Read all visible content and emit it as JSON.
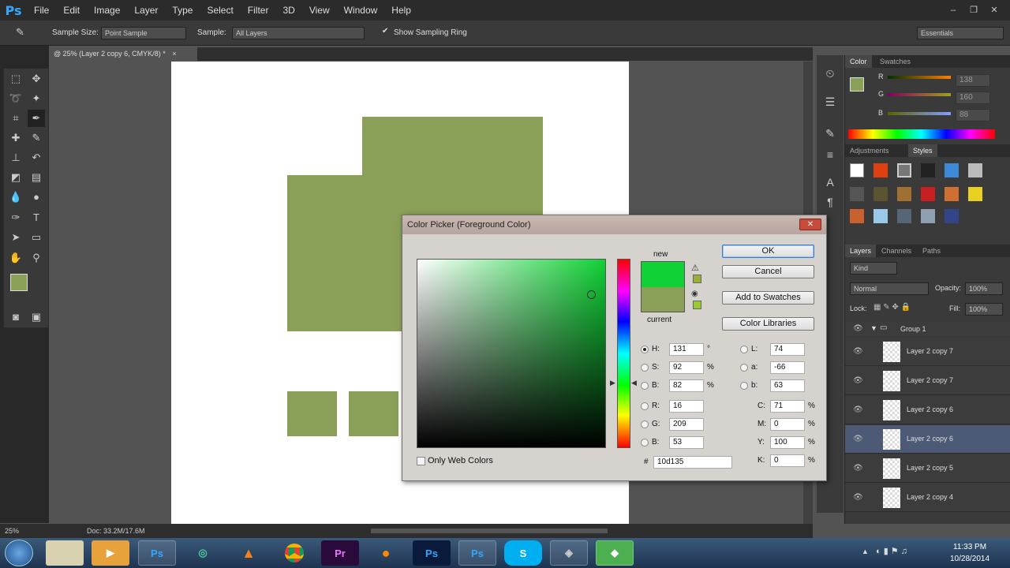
{
  "app": {
    "logo": "Ps"
  },
  "menu": [
    "File",
    "Edit",
    "Image",
    "Layer",
    "Type",
    "Select",
    "Filter",
    "3D",
    "View",
    "Window",
    "Help"
  ],
  "window_controls": [
    "–",
    "❐",
    "✕"
  ],
  "options_bar": {
    "sample_size_label": "Sample Size:",
    "sample_size_value": "Point Sample",
    "sample_label": "Sample:",
    "sample_value": "All Layers",
    "show_ring_label": "Show Sampling Ring",
    "workspace": "Essentials"
  },
  "document_tab": {
    "title": "@ 25% (Layer 2 copy 6, CMYK/8) *",
    "close": "×"
  },
  "status_bar": {
    "zoom": "25%",
    "doc": "Doc: 33.2M/17.6M"
  },
  "color_panel": {
    "tabs": [
      "Color",
      "Swatches"
    ],
    "fg_color": "#8a9f58",
    "sliders": [
      {
        "label": "R",
        "value": "138"
      },
      {
        "label": "G",
        "value": "160"
      },
      {
        "label": "B",
        "value": "88"
      }
    ]
  },
  "styles_panel": {
    "tabs": [
      "Adjustments",
      "Styles"
    ]
  },
  "layers_panel": {
    "tabs": [
      "Layers",
      "Channels",
      "Paths"
    ],
    "kind": "Kind",
    "blend_mode": "Normal",
    "opacity_label": "Opacity:",
    "opacity_value": "100%",
    "lock_label": "Lock:",
    "fill_label": "Fill:",
    "fill_value": "100%",
    "group_name": "Group 1",
    "layers": [
      "Layer 2 copy 7",
      "Layer 2 copy 7",
      "Layer 2 copy 6",
      "Layer 2 copy 6",
      "Layer 2 copy 5",
      "Layer 2 copy 4"
    ]
  },
  "dialog": {
    "title": "Color Picker (Foreground Color)",
    "close": "✕",
    "new_label": "new",
    "current_label": "current",
    "new_color": "#10d135",
    "current_color": "#8a9f58",
    "ok": "OK",
    "cancel": "Cancel",
    "add_swatches": "Add to Swatches",
    "color_libraries": "Color Libraries",
    "hsb": [
      {
        "label": "H:",
        "value": "131",
        "unit": "°"
      },
      {
        "label": "S:",
        "value": "92",
        "unit": "%"
      },
      {
        "label": "B:",
        "value": "82",
        "unit": "%"
      }
    ],
    "rgb": [
      {
        "label": "R:",
        "value": "16"
      },
      {
        "label": "G:",
        "value": "209"
      },
      {
        "label": "B:",
        "value": "53"
      }
    ],
    "lab": [
      {
        "label": "L:",
        "value": "74"
      },
      {
        "label": "a:",
        "value": "-66"
      },
      {
        "label": "b:",
        "value": "63"
      }
    ],
    "cmyk": [
      {
        "label": "C:",
        "value": "71",
        "unit": "%"
      },
      {
        "label": "M:",
        "value": "0",
        "unit": "%"
      },
      {
        "label": "Y:",
        "value": "100",
        "unit": "%"
      },
      {
        "label": "K:",
        "value": "0",
        "unit": "%"
      }
    ],
    "hex_label": "#",
    "hex_value": "10d135",
    "only_web_colors": "Only Web Colors"
  },
  "taskbar": {
    "time": "11:33 PM",
    "date": "10/28/2014",
    "apps": [
      "Ps",
      "Pr",
      "Ps",
      "Ps",
      "S"
    ]
  }
}
